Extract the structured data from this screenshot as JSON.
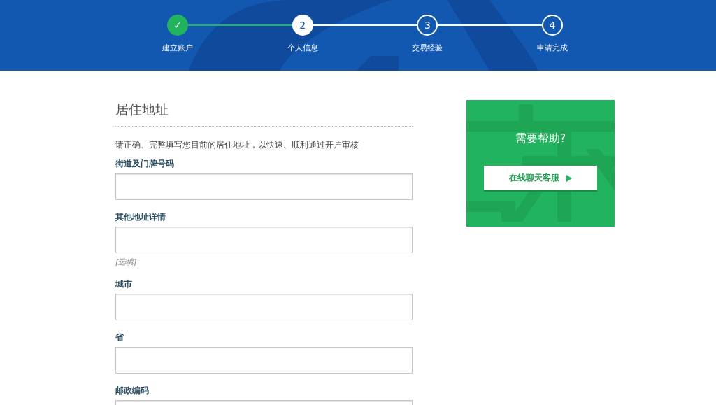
{
  "steps": [
    {
      "number": "✓",
      "label": "建立账户",
      "completed": true,
      "selected": false
    },
    {
      "number": "2",
      "label": "个人信息",
      "completed": false,
      "selected": true
    },
    {
      "number": "3",
      "label": "交易经验",
      "completed": false,
      "selected": false
    },
    {
      "number": "4",
      "label": "申请完成",
      "completed": false,
      "selected": false
    }
  ],
  "form": {
    "title": "居住地址",
    "intro": "请正确、完整填写您目前的居住地址，以快速、顺利通过开户审核",
    "fields": [
      {
        "label": "街道及门牌号码"
      },
      {
        "label": "其他地址详情",
        "hint": "[选填]"
      },
      {
        "label": "城市"
      },
      {
        "label": "省"
      },
      {
        "label": "邮政编码"
      }
    ]
  },
  "help": {
    "title": "需要帮助?",
    "button": "在线聊天客服"
  }
}
